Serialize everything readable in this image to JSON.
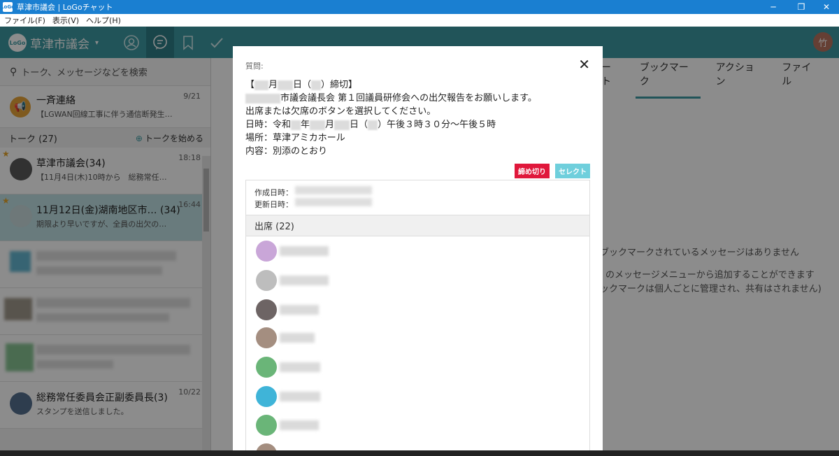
{
  "window": {
    "title": "草津市議会 | LoGoチャット",
    "app_icon": "LoGo",
    "min": "─",
    "restore": "❐",
    "close": "✕"
  },
  "menu": [
    "ファイル(F)",
    "表示(V)",
    "ヘルプ(H)"
  ],
  "header": {
    "org_name": "草津市議会",
    "logo": "LoGo",
    "caret": "▾",
    "user_initial": "竹",
    "icons": [
      "person-icon",
      "chat-icon",
      "bookmark-icon",
      "check-icon"
    ]
  },
  "sidebar": {
    "search_placeholder": "トーク、メッセージなどを検索",
    "broadcast": {
      "title": "一斉連絡",
      "subtitle": "【LGWAN回線工事に伴う通信断発生…",
      "date": "9/21"
    },
    "talk_header": "トーク (27)",
    "start_talk": "トークを始める",
    "rooms": [
      {
        "name": "草津市議会(34)",
        "last": "【11月4日(木)10時から　総務常任…",
        "time": "18:18",
        "starred": true
      },
      {
        "name": "11月12日(金)湖南地区市…  (34)",
        "last": "期限より早いですが、全員の出欠の…",
        "time": "16:44",
        "starred": true
      },
      {
        "name": "",
        "last": "",
        "time": ""
      },
      {
        "name": "",
        "last": "",
        "time": ""
      },
      {
        "name": "",
        "last": "",
        "time": ""
      },
      {
        "name": "総務常任委員会正副委員長(3)",
        "last": "スタンプを送信しました。",
        "time": "10/22"
      }
    ]
  },
  "right": {
    "tabs": [
      "ート",
      "ブックマーク",
      "アクション",
      "ファイル"
    ],
    "empty_lines": [
      "ブックマークされているメッセージはありません",
      "のメッセージメニューから追加することができます",
      "ックマークは個人ごとに管理され、共有はされません)"
    ]
  },
  "modal": {
    "label": "質問:",
    "close": "✕",
    "lines": {
      "l1a": "【",
      "l1b": "月",
      "l1c": "日（",
      "l1d": "）締切】",
      "l2": "市議会議長会 第１回議員研修会への出欠報告をお願いします。",
      "l3": "出席または欠席のボタンを選択してください。",
      "l4a": "日時：令和",
      "l4b": "年",
      "l4c": "月",
      "l4d": "日（",
      "l4e": "）午後３時３０分～午後５時",
      "l5": "場所：草津アミカホール",
      "l6": "内容：別添のとおり"
    },
    "tag_deadline": "締め切り",
    "tag_select": "セレクト",
    "created_label": "作成日時：",
    "updated_label": "更新日時：",
    "attend_header": "出席 (22)"
  },
  "colors": {
    "header_teal": "#3d9aa3",
    "tag_red": "#e0173b",
    "tag_cyan": "#6fcfdc",
    "titlebar_blue": "#1a7fd1"
  }
}
